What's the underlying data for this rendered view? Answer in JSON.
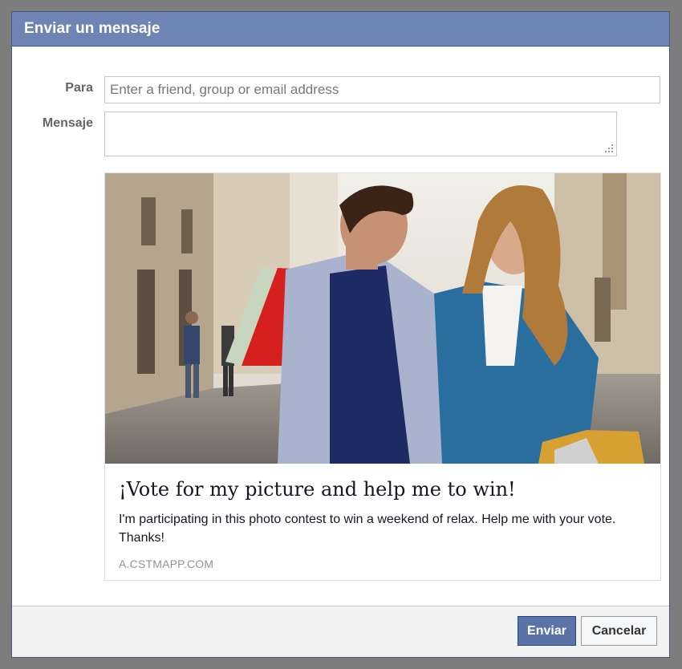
{
  "dialog": {
    "title": "Enviar un mensaje"
  },
  "form": {
    "to_label": "Para",
    "to_placeholder": "Enter a friend, group or email address",
    "message_label": "Mensaje",
    "message_value": ""
  },
  "share_card": {
    "image_icon": "photo-couple-shopping",
    "title": "¡Vote for my picture and help me to win!",
    "description": "I'm participating in this photo contest to win a weekend of relax. Help me with your vote. Thanks!",
    "domain": "A.CSTMAPP.COM"
  },
  "footer": {
    "send_label": "Enviar",
    "cancel_label": "Cancelar"
  },
  "colors": {
    "titlebar": "#6d84b4",
    "primary_button": "#5b74a8",
    "overlay": "#7d7d7d"
  }
}
